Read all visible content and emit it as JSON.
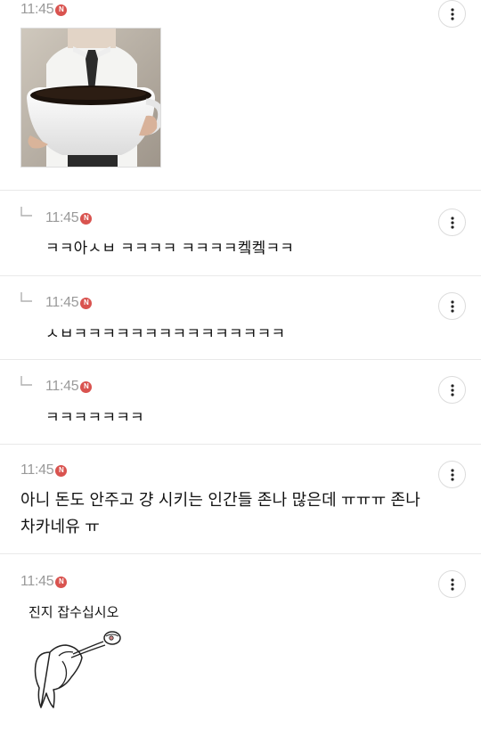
{
  "comments": [
    {
      "time": "11:45",
      "badge": "N",
      "image": "man-holding-giant-coffee-cup"
    },
    {
      "time": "11:45",
      "badge": "N",
      "text": "ㅋㅋ아ㅅㅂ ㅋㅋㅋㅋ ㅋㅋㅋㅋ켘켘ㅋㅋ"
    },
    {
      "time": "11:45",
      "badge": "N",
      "text": "ㅅㅂㅋㅋㅋㅋㅋㅋㅋㅋㅋㅋㅋㅋㅋㅋㅋ"
    },
    {
      "time": "11:45",
      "badge": "N",
      "text": "ㅋㅋㅋㅋㅋㅋㅋ"
    },
    {
      "time": "11:45",
      "badge": "N",
      "text_line1": "아니 돈도 안주고 걍 시키는 인간들 존나 많은데 ㅠㅠㅠ 존나",
      "text_line2": "차카네유 ㅠ"
    },
    {
      "time": "11:45",
      "badge": "N",
      "sticker_text": "진지 잡수십시오"
    }
  ],
  "icons": {
    "more": "more-vertical-icon",
    "reply": "reply-arrow-icon"
  },
  "colors": {
    "badge": "#d9534f",
    "time": "#9a9a9a",
    "divider": "#e9e9e9"
  }
}
